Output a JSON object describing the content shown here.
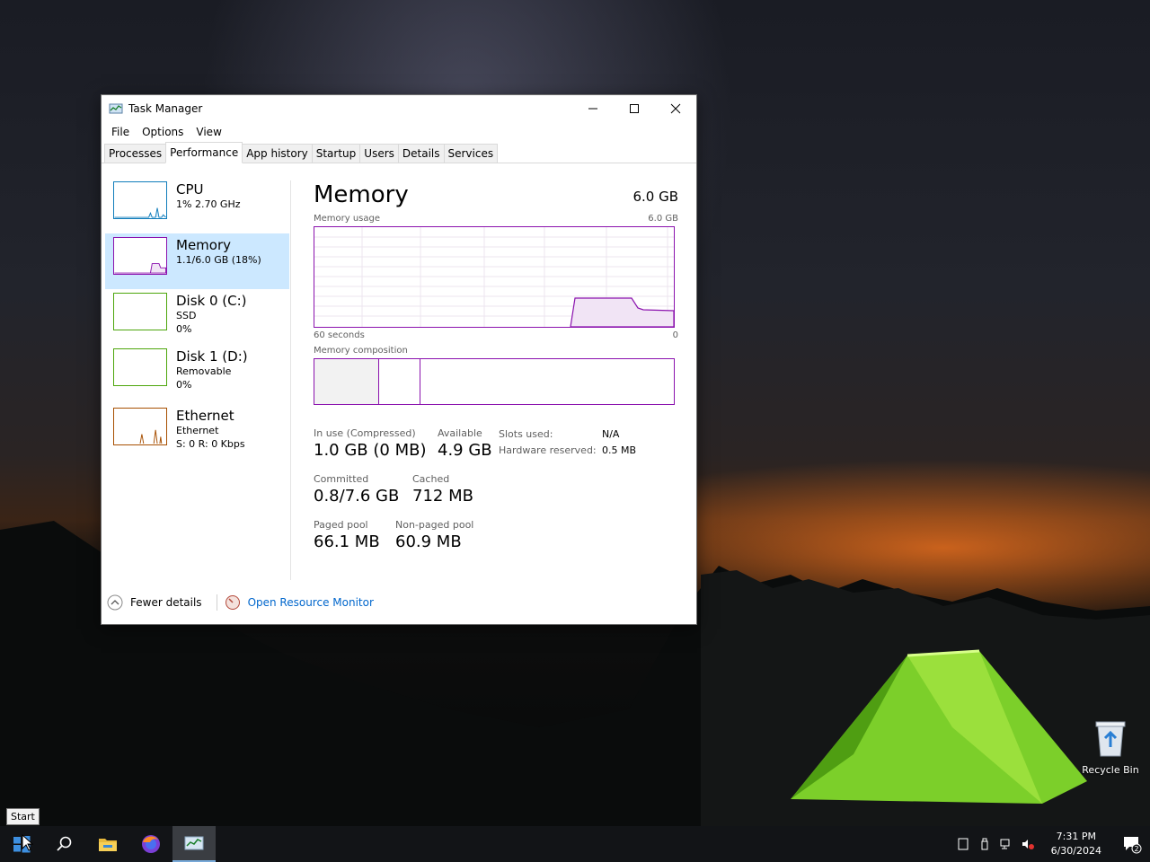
{
  "window": {
    "title": "Task Manager",
    "menu": [
      "File",
      "Options",
      "View"
    ],
    "tabs": [
      "Processes",
      "Performance",
      "App history",
      "Startup",
      "Users",
      "Details",
      "Services"
    ],
    "active_tab": "Performance"
  },
  "sidebar": {
    "cpu": {
      "title": "CPU",
      "sub1": "1%  2.70 GHz",
      "color": "#117dbb"
    },
    "memory": {
      "title": "Memory",
      "sub1": "1.1/6.0 GB (18%)",
      "color": "#8b12ae"
    },
    "disk0": {
      "title": "Disk 0 (C:)",
      "sub1": "SSD",
      "sub2": "0%",
      "color": "#4da60c"
    },
    "disk1": {
      "title": "Disk 1 (D:)",
      "sub1": "Removable",
      "sub2": "0%",
      "color": "#4da60c"
    },
    "ethernet": {
      "title": "Ethernet",
      "sub1": "Ethernet",
      "sub2": "S: 0 R: 0 Kbps",
      "color": "#a74f01"
    }
  },
  "memory_panel": {
    "title": "Memory",
    "total": "6.0 GB",
    "usage_label": "Memory usage",
    "usage_max": "6.0 GB",
    "axis_left": "60 seconds",
    "axis_right": "0",
    "composition_label": "Memory composition",
    "in_use_label": "In use (Compressed)",
    "in_use_value": "1.0 GB (0 MB)",
    "available_label": "Available",
    "available_value": "4.9 GB",
    "committed_label": "Committed",
    "committed_value": "0.8/7.6 GB",
    "cached_label": "Cached",
    "cached_value": "712 MB",
    "paged_label": "Paged pool",
    "paged_value": "66.1 MB",
    "nonpaged_label": "Non-paged pool",
    "nonpaged_value": "60.9 MB",
    "slots_label": "Slots used:",
    "slots_value": "N/A",
    "hwres_label": "Hardware reserved:",
    "hwres_value": "0.5 MB"
  },
  "footer": {
    "fewer_details": "Fewer details",
    "open_resmon": "Open Resource Monitor"
  },
  "desktop": {
    "recycle_bin": "Recycle Bin"
  },
  "taskbar": {
    "start_tooltip": "Start",
    "time": "7:31 PM",
    "date": "6/30/2024",
    "notification_count": "2"
  },
  "icons": {
    "start": "windows-logo-icon",
    "search": "search-icon",
    "explorer": "folder-icon",
    "firefox": "firefox-icon",
    "taskmgr": "task-manager-icon"
  }
}
